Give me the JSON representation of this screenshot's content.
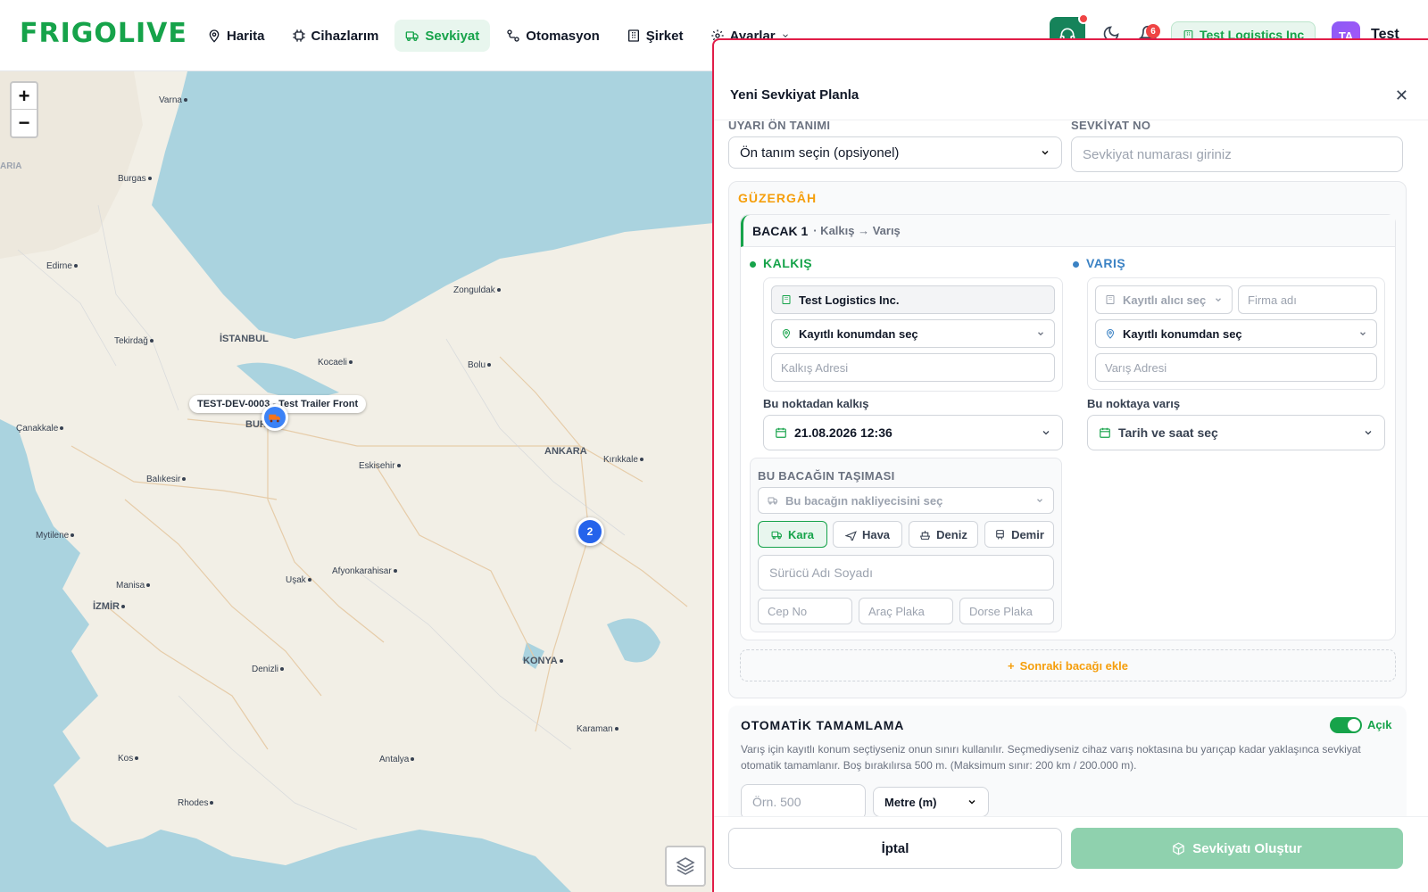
{
  "brand": {
    "logo_text": "FRIGOLIVE",
    "accent": "#16a34a"
  },
  "nav": {
    "items": [
      {
        "label": "Harita",
        "icon": "map-pin-icon"
      },
      {
        "label": "Cihazlarım",
        "icon": "chip-icon"
      },
      {
        "label": "Sevkiyat",
        "icon": "truck-icon",
        "active": true
      },
      {
        "label": "Otomasyon",
        "icon": "workflow-icon"
      },
      {
        "label": "Şirket",
        "icon": "building-icon"
      },
      {
        "label": "Ayarlar",
        "icon": "gear-icon"
      }
    ]
  },
  "header": {
    "notification_count": "6",
    "company": "Test Logistics Inc",
    "avatar_initials": "TA",
    "user_name": "Test"
  },
  "map": {
    "zoom_in": "+",
    "zoom_out": "−",
    "device_label": "TEST-DEV-0003 - Test Trailer Front",
    "cluster_count": "2",
    "cities": [
      "Varna",
      "ARIA",
      "Burgas",
      "Edirne",
      "Zonguldak",
      "Tekirdağ",
      "İSTANBUL",
      "Kocaeli",
      "Bolu",
      "Çanakkale",
      "BURSA",
      "ANKARA",
      "Kırıkkale",
      "Eskisehir",
      "Balıkesir",
      "Mytilene",
      "Afyonkarahisar",
      "Uşak",
      "Manisa",
      "İZMİR",
      "KONYA",
      "Denizli",
      "Karaman",
      "Kos",
      "Antalya",
      "Rhodes"
    ]
  },
  "panel": {
    "title": "Yeni Sevkiyat Planla",
    "preset_label": "UYARI ÖN TANIMI",
    "preset_value": "Ön tanım seçin (opsiyonel)",
    "shipment_no_label": "SEVKİYAT NO",
    "shipment_no_placeholder": "Sevkiyat numarası giriniz",
    "route_title": "GÜZERGÂH",
    "leg": {
      "name": "BACAK 1",
      "subtitle": "· Kalkış → Varış",
      "origin_title": "KALKIŞ",
      "origin_company": "Test Logistics Inc.",
      "origin_location": "Kayıtlı konumdan seç",
      "origin_address_placeholder": "Kalkış Adresi",
      "departure_label": "Bu noktadan kalkış",
      "departure_value": "21.08.2026 12:36",
      "dest_title": "VARIŞ",
      "dest_receiver": "Kayıtlı alıcı seç",
      "dest_company_placeholder": "Firma adı",
      "dest_location": "Kayıtlı konumdan seç",
      "dest_address_placeholder": "Varış Adresi",
      "arrival_label": "Bu noktaya varış",
      "arrival_value": "Tarih ve saat seç",
      "transport_title": "BU BACAĞIN TAŞIMASI",
      "carrier_placeholder": "Bu bacağın nakliyecisini seç",
      "modes": [
        "Kara",
        "Hava",
        "Deniz",
        "Demir"
      ],
      "driver_placeholder": "Sürücü Adı Soyadı",
      "phone_placeholder": "Cep No",
      "plate_placeholder": "Araç Plaka",
      "trailer_placeholder": "Dorse Plaka"
    },
    "add_leg": "Sonraki bacağı ekle",
    "auto_complete": {
      "title": "OTOMATİK TAMAMLAMA",
      "toggle_label": "Açık",
      "enabled": true,
      "description": "Varış için kayıtlı konum seçtiyseniz onun sınırı kullanılır. Seçmediyseniz cihaz varış noktasına bu yarıçap kadar yaklaşınca sevkiyat otomatik tamamlanır. Boş bırakılırsa 500 m. (Maksimum sınır: 200 km / 200.000 m).",
      "radius_placeholder": "Örn. 500",
      "unit_value": "Metre (m)"
    },
    "cancel_label": "İptal",
    "create_label": "Sevkiyatı Oluştur"
  }
}
